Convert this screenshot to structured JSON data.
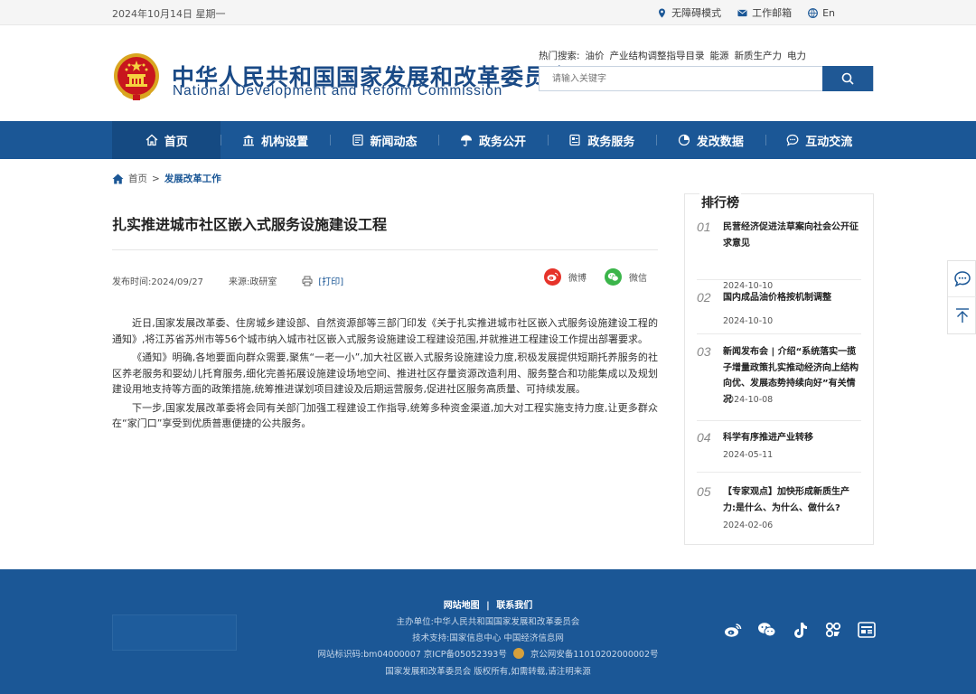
{
  "topbar": {
    "date": "2024年10月14日 星期一",
    "accessibility": "无障碍模式",
    "mail": "工作邮箱",
    "lang": "En"
  },
  "header": {
    "title_cn": "中华人民共和国国家发展和改革委员会",
    "title_en": "National Development and Reform Commission",
    "hot_label": "热门搜索:",
    "hot_items": [
      "油价",
      "产业结构调整指导目录",
      "能源",
      "新质生产力",
      "电力"
    ],
    "search_placeholder": "请输入关键字"
  },
  "nav": {
    "items": [
      {
        "label": "首页",
        "icon": "home-icon"
      },
      {
        "label": "机构设置",
        "icon": "building-icon"
      },
      {
        "label": "新闻动态",
        "icon": "news-icon"
      },
      {
        "label": "政务公开",
        "icon": "umbrella-icon"
      },
      {
        "label": "政务服务",
        "icon": "service-icon"
      },
      {
        "label": "发改数据",
        "icon": "pie-chart-icon"
      },
      {
        "label": "互动交流",
        "icon": "chat-icon"
      }
    ]
  },
  "breadcrumb": {
    "home": "首页",
    "separator": ">",
    "current": "发展改革工作"
  },
  "article": {
    "title": "扎实推进城市社区嵌入式服务设施建设工程",
    "publish_time": "发布时间:2024/09/27",
    "source": "来源:政研室",
    "print": "[打印]",
    "share_weibo": "微博",
    "share_wechat": "微信",
    "paragraphs": [
      "近日,国家发展改革委、住房城乡建设部、自然资源部等三部门印发《关于扎实推进城市社区嵌入式服务设施建设工程的通知》,将江苏省苏州市等56个城市纳入城市社区嵌入式服务设施建设工程建设范围,并就推进工程建设工作提出部署要求。",
      "《通知》明确,各地要面向群众需要,聚焦“一老一小”,加大社区嵌入式服务设施建设力度,积极发展提供短期托养服务的社区养老服务和婴幼儿托育服务,细化完善拓展设施建设场地空间、推进社区存量资源改造利用、服务整合和功能集成以及规划建设用地支持等方面的政策措施,统筹推进谋划项目建设及后期运营服务,促进社区服务高质量、可持续发展。",
      "下一步,国家发展改革委将会同有关部门加强工程建设工作指导,统筹多种资金渠道,加大对工程实施支持力度,让更多群众在“家门口”享受到优质普惠便捷的公共服务。"
    ]
  },
  "ranking": {
    "title": "排行榜",
    "items": [
      {
        "num": "01",
        "title": "民营经济促进法草案向社会公开征求意见",
        "date": "2024-10-10"
      },
      {
        "num": "02",
        "title": "国内成品油价格按机制调整",
        "date": "2024-10-10"
      },
      {
        "num": "03",
        "title": "新闻发布会 | 介绍“系统落实一揽子增量政策扎实推动经济向上结构向优、发展态势持续向好”有关情况",
        "date": "2024-10-08"
      },
      {
        "num": "04",
        "title": "科学有序推进产业转移",
        "date": "2024-05-11"
      },
      {
        "num": "05",
        "title": "【专家观点】加快形成新质生产力:是什么、为什么、做什么?",
        "date": "2024-02-06"
      }
    ]
  },
  "footer": {
    "sitemap": "网站地图",
    "divider": "|",
    "contact": "联系我们",
    "sponsor": "主办单位:中华人民共和国国家发展和改革委员会",
    "tech": "技术支持:国家信息中心 中国经济信息网",
    "id_line_a": "网站标识码:bm04000007 京ICP备05052393号",
    "id_line_b": "京公网安备11010202000002号",
    "copyright": "国家发展和改革委员会 版权所有,如需转载,请注明来源"
  },
  "colors": {
    "brand_blue": "#1b5796",
    "title_blue": "#1a4a86"
  }
}
